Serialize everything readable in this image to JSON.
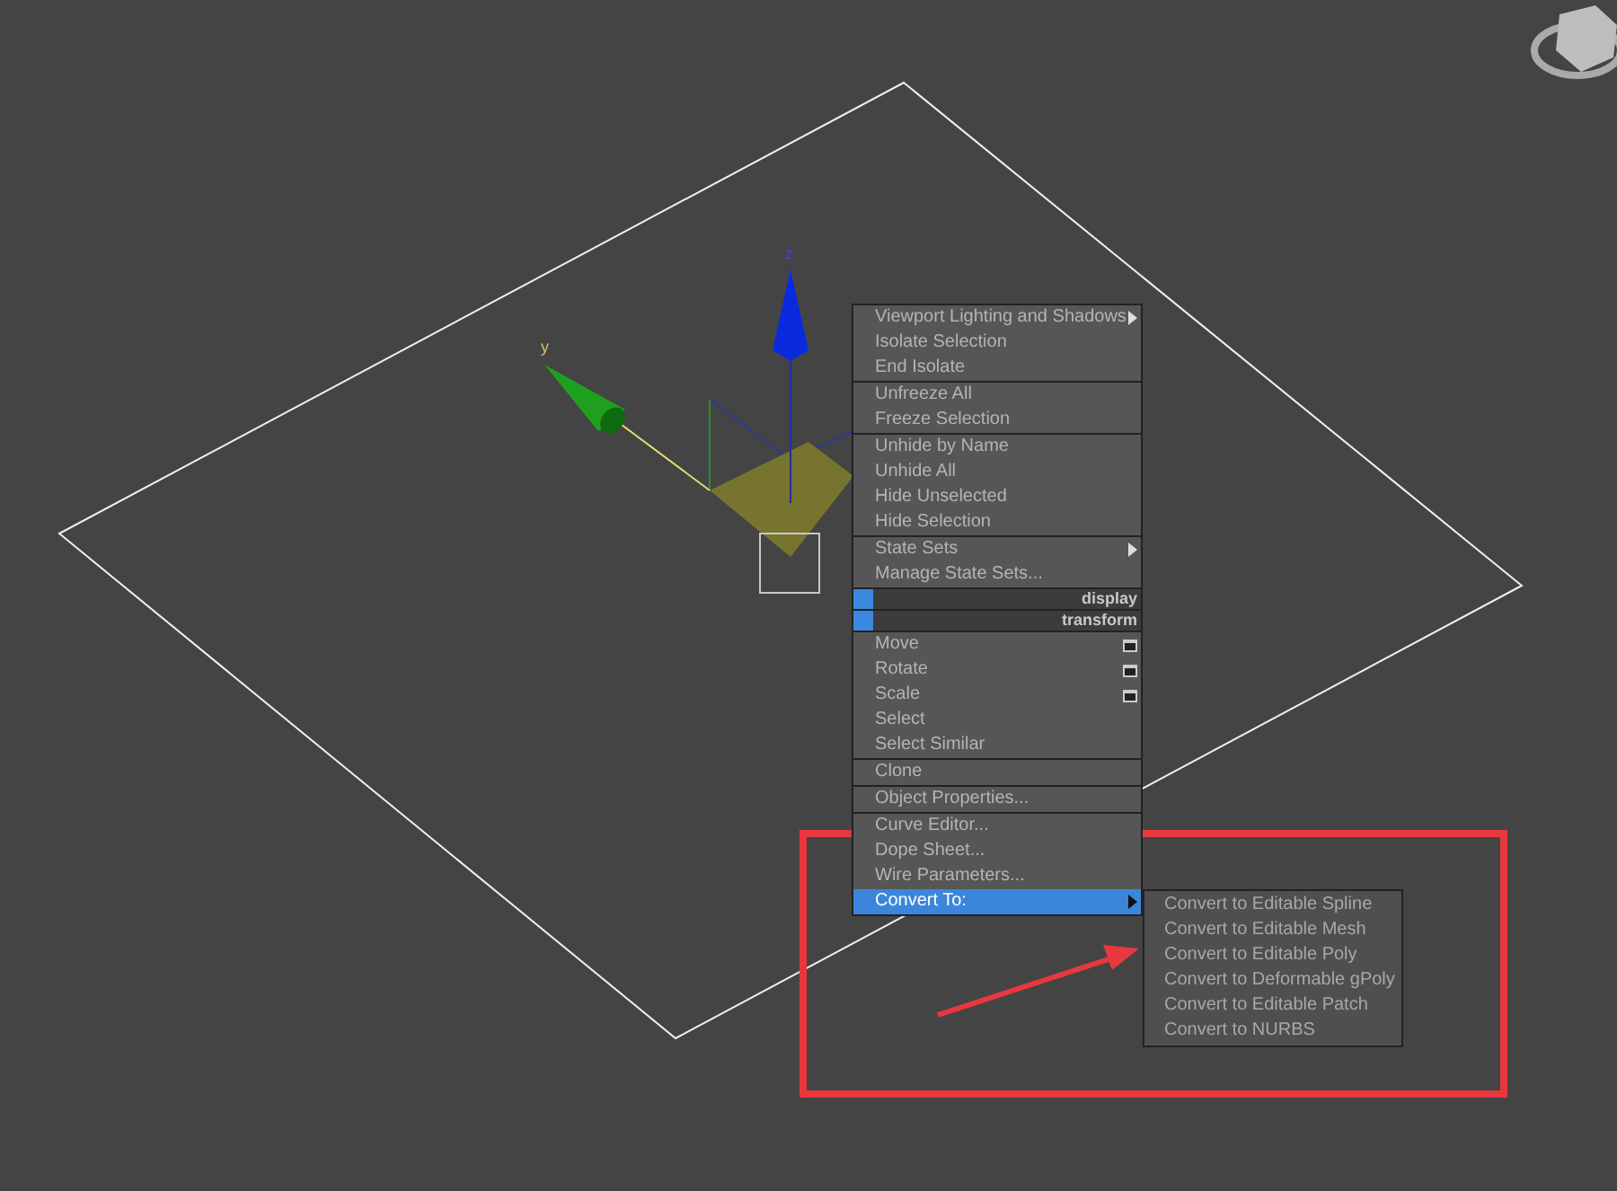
{
  "viewport": {
    "axis_labels": [
      "z",
      "y"
    ]
  },
  "quad_menu": {
    "groups": [
      {
        "items": [
          {
            "kind": "item",
            "label": "Viewport Lighting and Shadows",
            "submenu": true,
            "options": false,
            "selected": false
          },
          {
            "kind": "item",
            "label": "Isolate Selection",
            "submenu": false,
            "options": false,
            "selected": false
          },
          {
            "kind": "item",
            "label": "End Isolate",
            "submenu": false,
            "options": false,
            "selected": false
          }
        ]
      },
      {
        "items": [
          {
            "kind": "item",
            "label": "Unfreeze All",
            "submenu": false,
            "options": false,
            "selected": false
          },
          {
            "kind": "item",
            "label": "Freeze Selection",
            "submenu": false,
            "options": false,
            "selected": false
          }
        ]
      },
      {
        "items": [
          {
            "kind": "item",
            "label": "Unhide by Name",
            "submenu": false,
            "options": false,
            "selected": false
          },
          {
            "kind": "item",
            "label": "Unhide All",
            "submenu": false,
            "options": false,
            "selected": false
          },
          {
            "kind": "item",
            "label": "Hide Unselected",
            "submenu": false,
            "options": false,
            "selected": false
          },
          {
            "kind": "item",
            "label": "Hide Selection",
            "submenu": false,
            "options": false,
            "selected": false
          }
        ]
      },
      {
        "items": [
          {
            "kind": "item",
            "label": "State Sets",
            "submenu": true,
            "options": false,
            "selected": false
          },
          {
            "kind": "item",
            "label": "Manage State Sets...",
            "submenu": false,
            "options": false,
            "selected": false
          }
        ]
      },
      {
        "items": [
          {
            "kind": "header",
            "label": "display"
          }
        ]
      },
      {
        "items": [
          {
            "kind": "header",
            "label": "transform"
          }
        ]
      },
      {
        "items": [
          {
            "kind": "item",
            "label": "Move",
            "submenu": false,
            "options": true,
            "selected": false
          },
          {
            "kind": "item",
            "label": "Rotate",
            "submenu": false,
            "options": true,
            "selected": false
          },
          {
            "kind": "item",
            "label": "Scale",
            "submenu": false,
            "options": true,
            "selected": false
          },
          {
            "kind": "item",
            "label": "Select",
            "submenu": false,
            "options": false,
            "selected": false
          },
          {
            "kind": "item",
            "label": "Select Similar",
            "submenu": false,
            "options": false,
            "selected": false
          }
        ]
      },
      {
        "items": [
          {
            "kind": "item",
            "label": "Clone",
            "submenu": false,
            "options": false,
            "selected": false
          }
        ]
      },
      {
        "items": [
          {
            "kind": "item",
            "label": "Object Properties...",
            "submenu": false,
            "options": false,
            "selected": false
          }
        ]
      },
      {
        "items": [
          {
            "kind": "item",
            "label": "Curve Editor...",
            "submenu": false,
            "options": false,
            "selected": false
          },
          {
            "kind": "item",
            "label": "Dope Sheet...",
            "submenu": false,
            "options": false,
            "selected": false
          },
          {
            "kind": "item",
            "label": "Wire Parameters...",
            "submenu": false,
            "options": false,
            "selected": false
          },
          {
            "kind": "item",
            "label": "Convert To:",
            "submenu": true,
            "options": false,
            "selected": true
          }
        ]
      }
    ]
  },
  "submenu": {
    "items": [
      "Convert to Editable Spline",
      "Convert to Editable Mesh",
      "Convert to Editable Poly",
      "Convert to Deformable gPoly",
      "Convert to Editable Patch",
      "Convert to NURBS"
    ]
  }
}
